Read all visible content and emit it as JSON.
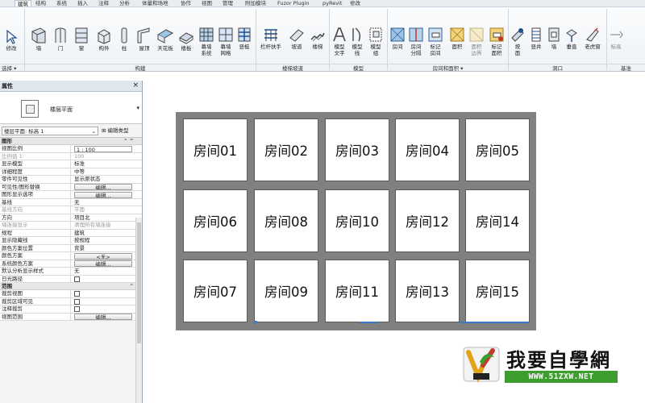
{
  "ribbon": {
    "tabs": [
      "建筑",
      "结构",
      "系统",
      "插入",
      "注释",
      "分析",
      "体量和场地",
      "协作",
      "视图",
      "管理",
      "附加模块",
      "Fuzor Plugin",
      "pyRevit",
      "修改"
    ],
    "active_tab": "建筑",
    "buttons": {
      "modify": "修改",
      "wall": "墙",
      "door": "门",
      "window": "窗",
      "component": "构件",
      "column": "柱",
      "roof": "屋顶",
      "ceiling": "天花板",
      "floor": "楼板",
      "curtain_system": "幕墙\n系统",
      "curtain_grid": "幕墙\n网格",
      "mullion": "竖梃",
      "railing": "栏杆扶手",
      "ramp": "坡道",
      "stair": "楼梯",
      "model_text": "模型\n文字",
      "model_line": "模型\n线",
      "model_group": "模型\n组",
      "room": "房间",
      "room_separator": "房间\n分隔",
      "tag_room": "标记\n房间",
      "area": "面积",
      "area_boundary": "面积\n边界",
      "tag_area": "标记\n面积",
      "by_face": "按\n面",
      "shaft": "竖井",
      "opening_wall": "墙",
      "vertical": "垂直",
      "dormer": "老虎窗",
      "level": "标高"
    },
    "panels": {
      "select": "选择 ▾",
      "build": "构建",
      "circulation": "楼梯坡道",
      "model": "模型",
      "room_area": "房间和面积 ▾",
      "opening": "洞口",
      "datum": "基准"
    }
  },
  "properties": {
    "title": "属性",
    "close": "×",
    "type_name": "楼层平面",
    "type_dropdown": "▾",
    "instance": "楼层平面: 标高 1",
    "edit_type": "编辑类型",
    "groups": [
      {
        "name": "图形",
        "ctl": "⌃ ^"
      },
      {
        "name": "范围",
        "ctl": "⌃"
      }
    ],
    "graphics_rows": [
      {
        "k": "视图比例",
        "v": "1 : 100",
        "kind": "box"
      },
      {
        "k": "比例值 1:",
        "v": "100",
        "kind": "dim"
      },
      {
        "k": "显示模型",
        "v": "标准",
        "kind": "text"
      },
      {
        "k": "详细程度",
        "v": "中等",
        "kind": "text"
      },
      {
        "k": "零件可见性",
        "v": "显示原状态",
        "kind": "text"
      },
      {
        "k": "可见性/图形替换",
        "v": "编辑...",
        "kind": "btn"
      },
      {
        "k": "图形显示选项",
        "v": "编辑...",
        "kind": "btn"
      },
      {
        "k": "基线",
        "v": "无",
        "kind": "text"
      },
      {
        "k": "基线方向",
        "v": "平面",
        "kind": "dim"
      },
      {
        "k": "方向",
        "v": "项目北",
        "kind": "text"
      },
      {
        "k": "墙连接显示",
        "v": "清理所有墙连接",
        "kind": "dim"
      },
      {
        "k": "规程",
        "v": "建筑",
        "kind": "text"
      },
      {
        "k": "显示隐藏线",
        "v": "按规程",
        "kind": "text"
      },
      {
        "k": "颜色方案位置",
        "v": "背景",
        "kind": "text"
      },
      {
        "k": "颜色方案",
        "v": "<无>",
        "kind": "btn"
      },
      {
        "k": "系统颜色方案",
        "v": "编辑...",
        "kind": "btn"
      },
      {
        "k": "默认分析显示样式",
        "v": "无",
        "kind": "text"
      },
      {
        "k": "日光路径",
        "v": "",
        "kind": "check"
      }
    ],
    "extent_rows": [
      {
        "k": "裁剪视图",
        "v": "",
        "kind": "check"
      },
      {
        "k": "裁剪区域可见",
        "v": "",
        "kind": "check"
      },
      {
        "k": "注释裁剪",
        "v": "",
        "kind": "check"
      },
      {
        "k": "视图范围",
        "v": "编辑...",
        "kind": "btn"
      }
    ]
  },
  "rooms": [
    "房间01",
    "房间02",
    "房间03",
    "房间04",
    "房间05",
    "房间06",
    "房间08",
    "房间10",
    "房间12",
    "房间14",
    "房间07",
    "房间09",
    "房间11",
    "房间13",
    "房间15"
  ],
  "watermark": {
    "name": "我要自學網",
    "url": "WWW.51ZXW.NET"
  },
  "colors": {
    "wall": "#808080",
    "selection_blue": "#3a79c8",
    "watermark_green": "#3c9e2c"
  }
}
